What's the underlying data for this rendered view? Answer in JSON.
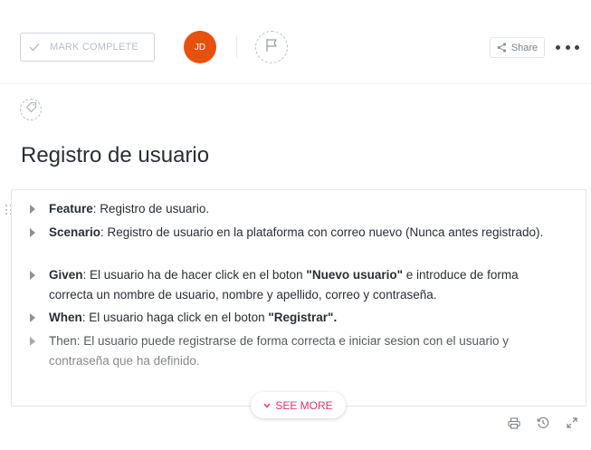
{
  "toolbar": {
    "mark_complete_label": "MARK COMPLETE",
    "assignee_initials": "JD",
    "assignee_color": "#e8500f",
    "share_label": "Share",
    "icons": [
      "check-icon",
      "flag-icon",
      "share-icon",
      "more-icon",
      "tag-icon"
    ]
  },
  "task": {
    "title": "Registro de usuario"
  },
  "description": {
    "items": [
      {
        "label": "Feature",
        "text": ": Registro de usuario."
      },
      {
        "label": "Scenario",
        "text": ": Registro de usuario en la plataforma con correo nuevo (Nunca antes registrado)."
      },
      {
        "label": "Given",
        "text_1": ": El usuario ha de hacer click en el boton ",
        "bold_1": "\"Nuevo usuario\"",
        "text_2": " e introduce de forma correcta un nombre de usuario, nombre y apellido, correo y contraseña."
      },
      {
        "label": "When",
        "text_1": ": El usuario haga click en el boton ",
        "bold_1": "\"Registrar\"."
      },
      {
        "text": "Then: El usuario puede registrarse de forma correcta e iniciar sesion con el usuario y contraseña que ha definido."
      }
    ],
    "see_more_label": "SEE MORE"
  },
  "colors": {
    "accent": "#e4336f",
    "text": "#2a2e34"
  }
}
